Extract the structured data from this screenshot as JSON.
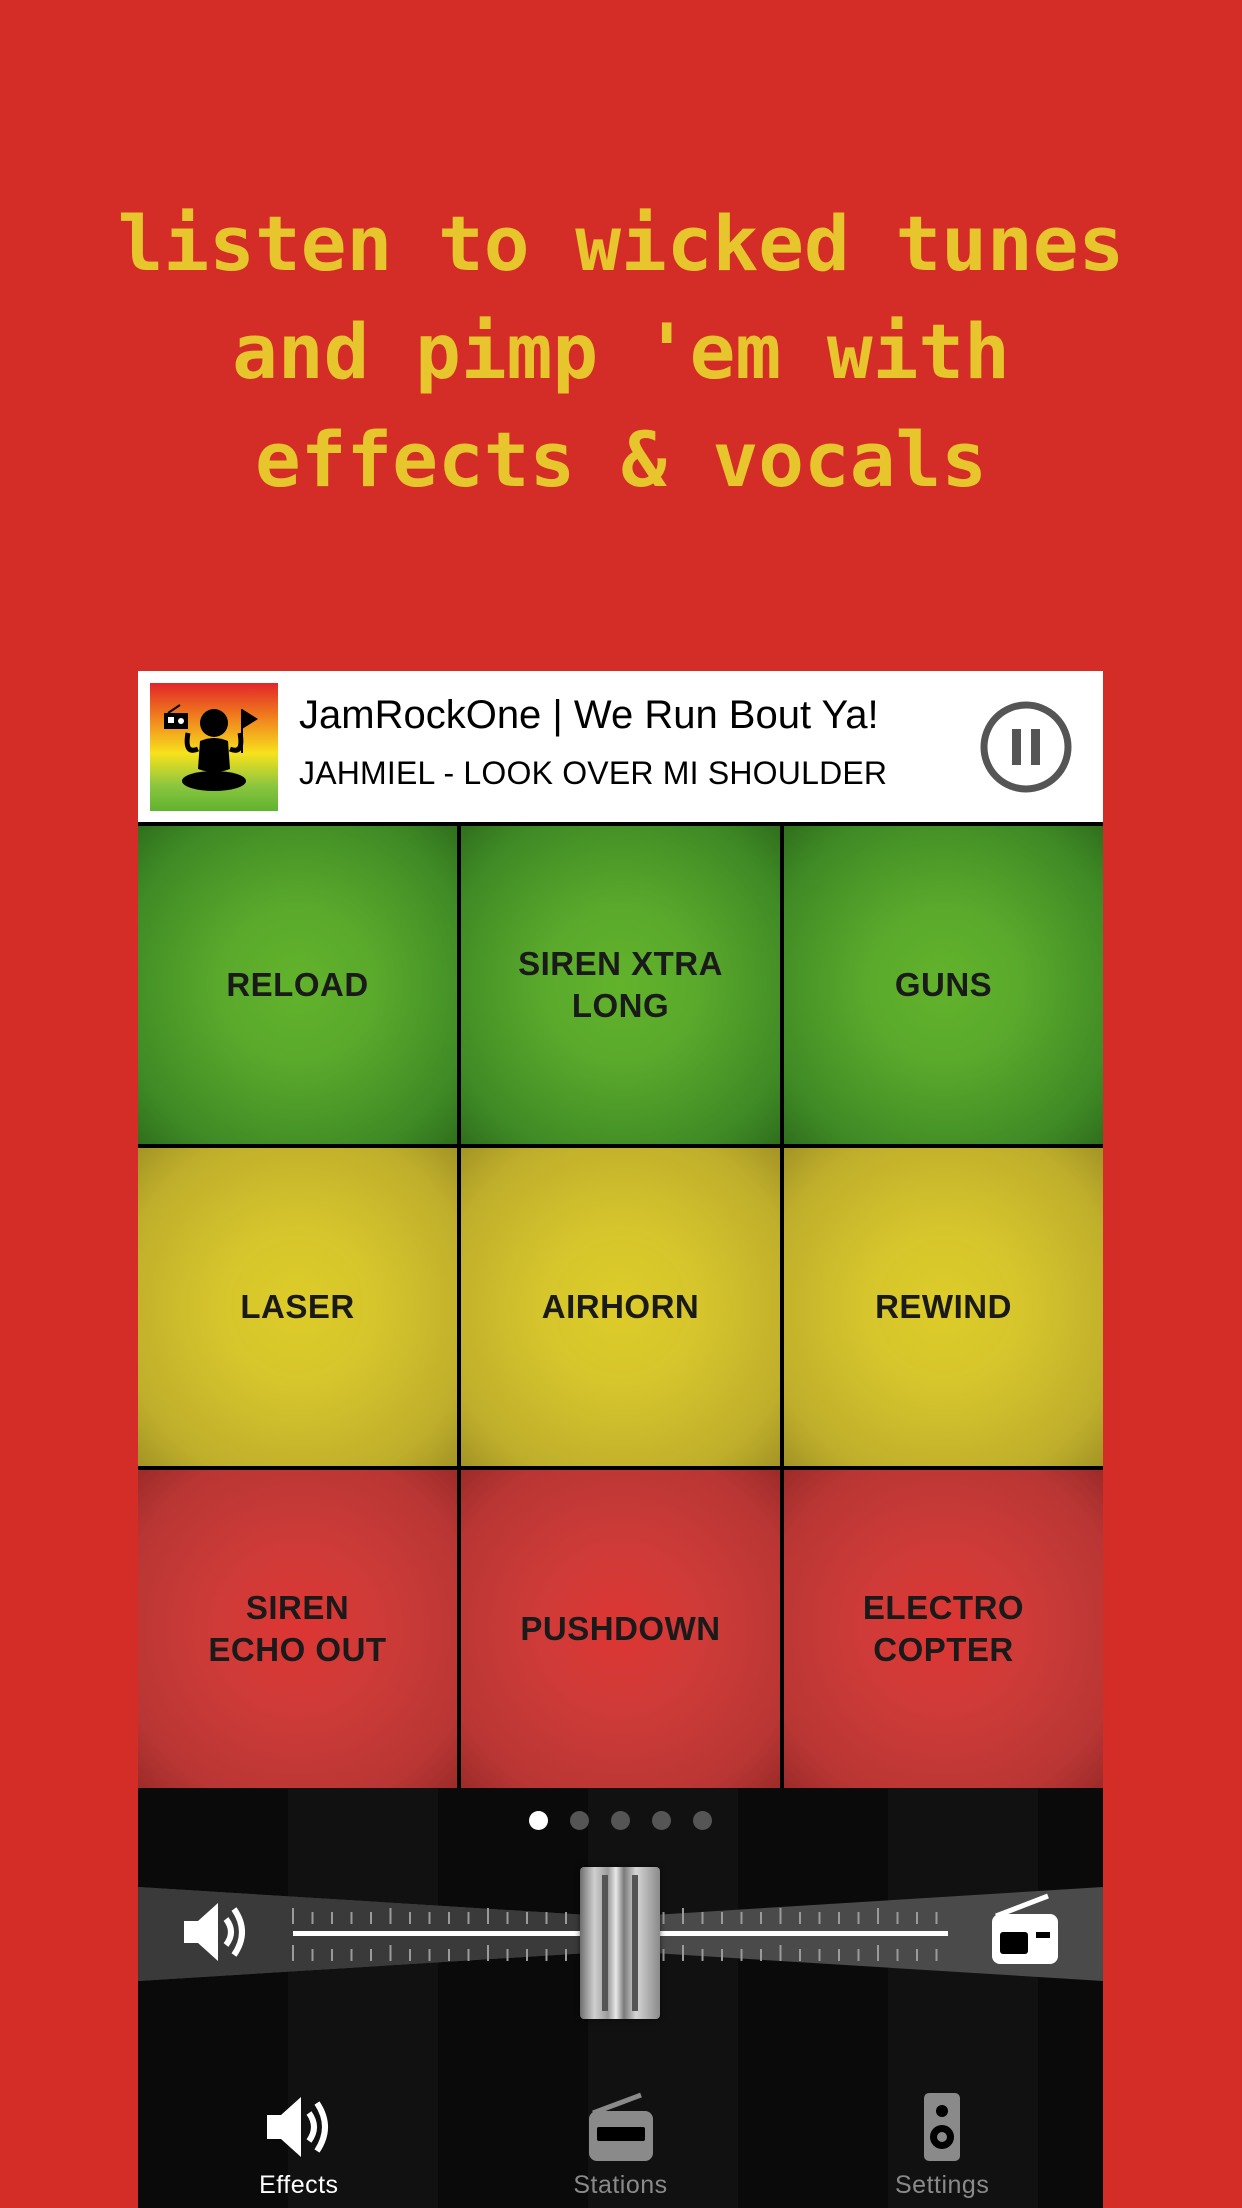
{
  "headline": {
    "line1": "listen to wicked tunes",
    "line2": "and pimp 'em with",
    "line3": "effects & vocals"
  },
  "colors": {
    "background": "#d42d28",
    "headline": "#e6c62c",
    "pad_green": "#5aa92c",
    "pad_yellow": "#d6c52c",
    "pad_red": "#cf3b38"
  },
  "now_playing": {
    "station": "JamRockOne | We Run Bout Ya!",
    "track": "JAHMIEL - LOOK OVER MI SHOULDER",
    "artwork_icon": "rasta-buddha-artwork",
    "control_icon": "pause-icon"
  },
  "pads": [
    {
      "label": "RELOAD",
      "color": "green"
    },
    {
      "label": "SIREN XTRA\nLONG",
      "color": "green"
    },
    {
      "label": "GUNS",
      "color": "green"
    },
    {
      "label": "LASER",
      "color": "yellow"
    },
    {
      "label": "AIRHORN",
      "color": "yellow"
    },
    {
      "label": "REWIND",
      "color": "yellow"
    },
    {
      "label": "SIREN\nECHO OUT",
      "color": "red"
    },
    {
      "label": "PUSHDOWN",
      "color": "red"
    },
    {
      "label": "ELECTRO\nCOPTER",
      "color": "red"
    }
  ],
  "pager": {
    "count": 5,
    "active": 0
  },
  "crossfader": {
    "left_icon": "speaker-icon",
    "right_icon": "radio-icon",
    "position": 0.5
  },
  "tabs": [
    {
      "label": "Effects",
      "icon": "speaker-icon",
      "active": true
    },
    {
      "label": "Stations",
      "icon": "radio-icon",
      "active": false
    },
    {
      "label": "Settings",
      "icon": "loudspeaker-icon",
      "active": false
    }
  ]
}
